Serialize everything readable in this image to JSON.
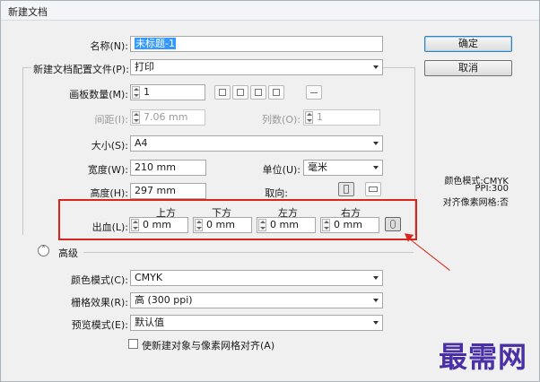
{
  "window": {
    "title": "新建文档"
  },
  "fields": {
    "name_label": "名称(N):",
    "name_value": "未标题-1",
    "profile_label": "新建文档配置文件(P):",
    "profile_value": "打印",
    "artboards_label": "画板数量(M):",
    "artboards_value": "1",
    "spacing_label": "间距(I):",
    "spacing_value": "7.06 mm",
    "columns_label": "列数(O):",
    "columns_value": "1",
    "size_label": "大小(S):",
    "size_value": "A4",
    "width_label": "宽度(W):",
    "width_value": "210 mm",
    "units_label": "单位(U):",
    "units_value": "毫米",
    "height_label": "高度(H):",
    "height_value": "297 mm",
    "orientation_label": "取向:"
  },
  "bleed": {
    "label": "出血(L):",
    "top_label": "上方",
    "bottom_label": "下方",
    "left_label": "左方",
    "right_label": "右方",
    "top": "0 mm",
    "bottom": "0 mm",
    "left": "0 mm",
    "right": "0 mm"
  },
  "advanced": {
    "label": "高级",
    "color_mode_label": "颜色模式(C):",
    "color_mode_value": "CMYK",
    "raster_label": "栅格效果(R):",
    "raster_value": "高 (300 ppi)",
    "preview_label": "预览模式(E):",
    "preview_value": "默认值",
    "align_checkbox_label": "使新建对象与像素网格对齐(A)"
  },
  "buttons": {
    "ok": "确定",
    "cancel": "取消"
  },
  "info": {
    "color_mode": "颜色模式:CMYK",
    "ppi": "PPI:300",
    "align": "对齐像素网格:否"
  },
  "watermark": "最需网",
  "colors": {
    "highlight": "#d9261c",
    "selection": "#3399ff",
    "watermark": "#4b2fa6"
  }
}
